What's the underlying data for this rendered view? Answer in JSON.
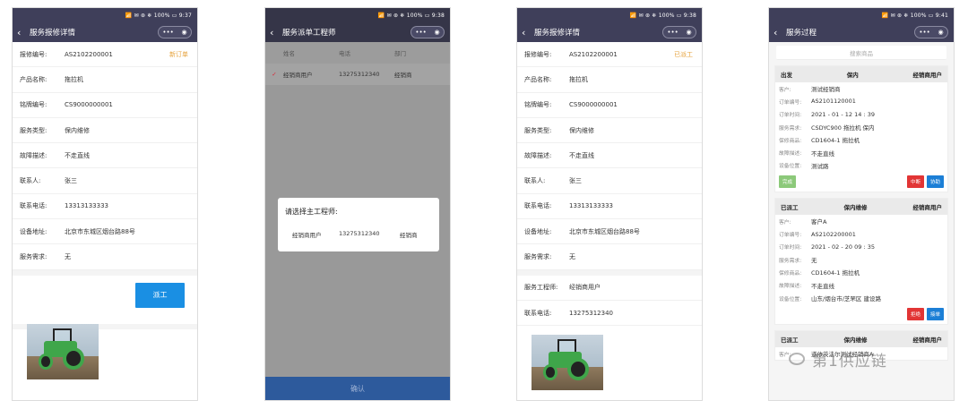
{
  "status_bar": {
    "p1": "📶 ✉ ⊛ ❄ 100% ▭ 9:37",
    "p2": "📶 ✉ ⊛ ❄ 100% ▭ 9:38",
    "p3": "📶 ✉ ⊛ ❄ 100% ▭ 9:38",
    "p4": "📶 ✉ ⊛ ❄ 100% ▭ 9:41"
  },
  "screen1": {
    "title": "服务报修详情",
    "fields": [
      {
        "label": "报修编号:",
        "value": "AS2102200001",
        "tag": "新订单"
      },
      {
        "label": "产品名称:",
        "value": "拖拉机"
      },
      {
        "label": "铭牌编号:",
        "value": "CS9000000001"
      },
      {
        "label": "服务类型:",
        "value": "保内维修"
      },
      {
        "label": "故障描述:",
        "value": "不走直线"
      },
      {
        "label": "联系人:",
        "value": "张三"
      },
      {
        "label": "联系电话:",
        "value": "13313133333"
      },
      {
        "label": "设备地址:",
        "value": "北京市东城区烟台路88号"
      },
      {
        "label": "服务需求:",
        "value": "无"
      }
    ],
    "dispatch_button": "派工"
  },
  "screen2": {
    "title": "服务派单工程师",
    "columns": [
      "姓名",
      "电话",
      "部门"
    ],
    "row": {
      "check": "✓",
      "name": "经销商用户",
      "phone": "13275312340",
      "dept": "经销商"
    },
    "modal": {
      "title": "请选择主工程师:",
      "name": "经销商用户",
      "phone": "13275312340",
      "dept": "经销商"
    },
    "confirm": "确认"
  },
  "screen3": {
    "title": "服务报修详情",
    "fields": [
      {
        "label": "报修编号:",
        "value": "AS2102200001",
        "tag": "已派工"
      },
      {
        "label": "产品名称:",
        "value": "拖拉机"
      },
      {
        "label": "铭牌编号:",
        "value": "CS9000000001"
      },
      {
        "label": "服务类型:",
        "value": "保内维修"
      },
      {
        "label": "故障描述:",
        "value": "不走直线"
      },
      {
        "label": "联系人:",
        "value": "张三"
      },
      {
        "label": "联系电话:",
        "value": "13313133333"
      },
      {
        "label": "设备地址:",
        "value": "北京市东城区烟台路88号"
      },
      {
        "label": "服务需求:",
        "value": "无"
      }
    ],
    "engineer": {
      "label": "服务工程师:",
      "value": "经销商用户"
    },
    "engineer_phone": {
      "label": "联系电话:",
      "value": "13275312340"
    }
  },
  "screen4": {
    "title": "服务过程",
    "search_placeholder": "搜索商品",
    "cards": [
      {
        "status": "出发",
        "type": "保内",
        "dealer": "经销商用户",
        "rows": [
          {
            "k": "客户:",
            "v": "测试经销商"
          },
          {
            "k": "订单编号:",
            "v": "AS2101120001"
          },
          {
            "k": "订单时间:",
            "v": "2021 - 01 - 12 14 : 39"
          },
          {
            "k": "服务需求:",
            "v": "CSDYC900 拖拉机 保内"
          },
          {
            "k": "保修商品:",
            "v": "CD1604-1 拖拉机"
          },
          {
            "k": "故障描述:",
            "v": "不走直线"
          },
          {
            "k": "设备位置:",
            "v": "测试路"
          }
        ],
        "btn_done": "完成",
        "btn_interrupt": "中断",
        "btn_help": "协助"
      },
      {
        "status": "已派工",
        "type": "保内维修",
        "dealer": "经销商用户",
        "rows": [
          {
            "k": "客户:",
            "v": "客户A"
          },
          {
            "k": "订单编号:",
            "v": "AS2102200001"
          },
          {
            "k": "订单时间:",
            "v": "2021 - 02 - 20 09 : 35"
          },
          {
            "k": "服务需求:",
            "v": "无"
          },
          {
            "k": "保修商品:",
            "v": "CD1604-1 拖拉机"
          },
          {
            "k": "故障描述:",
            "v": "不走直线"
          },
          {
            "k": "设备位置:",
            "v": "山东/烟台市/芝罘区 建设路"
          }
        ],
        "btn_reject": "拒绝",
        "btn_accept": "接单"
      },
      {
        "status": "已派工",
        "type": "保内维修",
        "dealer": "经销商用户",
        "rows": [
          {
            "k": "客户:",
            "v": "道依茨法尔测试经销商A"
          }
        ]
      }
    ]
  },
  "watermark": "第1供应链"
}
